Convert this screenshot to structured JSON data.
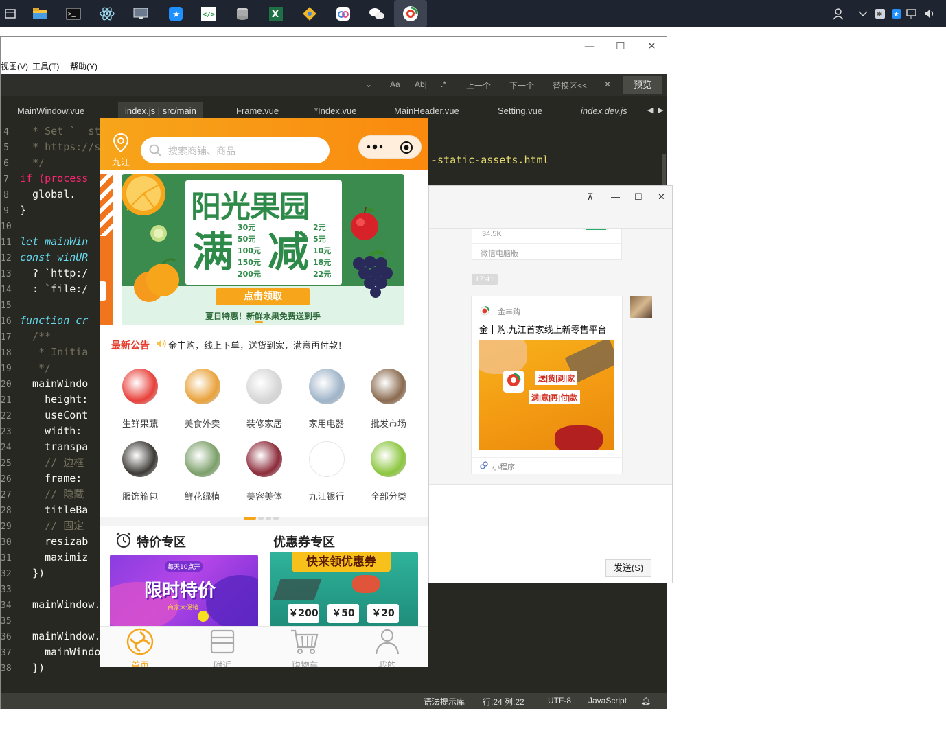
{
  "editor": {
    "menu": [
      "视图(V)",
      "工具(T)",
      "帮助(Y)"
    ],
    "find": {
      "case": "Aa",
      "word": "Ab|",
      "regex": ".*",
      "prev": "上一个",
      "next": "下一个",
      "replace": "替换区<<",
      "close": "✕"
    },
    "preview_label": "预览",
    "tabs": [
      "MainWindow.vue",
      "index.js | src/main",
      "Frame.vue",
      "*Index.vue",
      "MainHeader.vue",
      "Setting.vue",
      "index.dev.js"
    ],
    "code_lines": [
      {
        "n": "4",
        "text": "  * Set `__sta"
      },
      {
        "n": "5",
        "text": "  * https://si"
      },
      {
        "n": "6",
        "text": "  */"
      },
      {
        "n": "7",
        "text": "if (process"
      },
      {
        "n": "8",
        "text": "  global.__"
      },
      {
        "n": "9",
        "text": "}"
      },
      {
        "n": "10",
        "text": ""
      },
      {
        "n": "11",
        "text": "let mainWin"
      },
      {
        "n": "12",
        "text": "const winUR"
      },
      {
        "n": "13",
        "text": "  ? `http:/"
      },
      {
        "n": "14",
        "text": "  : `file:/"
      },
      {
        "n": "15",
        "text": ""
      },
      {
        "n": "16",
        "text": "function cr"
      },
      {
        "n": "17",
        "text": "  /**"
      },
      {
        "n": "18",
        "text": "   * Initia"
      },
      {
        "n": "19",
        "text": "   */"
      },
      {
        "n": "20",
        "text": "  mainWindo"
      },
      {
        "n": "21",
        "text": "    height:"
      },
      {
        "n": "22",
        "text": "    useCont"
      },
      {
        "n": "23",
        "text": "    width:"
      },
      {
        "n": "24",
        "text": "    transpa"
      },
      {
        "n": "25",
        "text": "    // 边框"
      },
      {
        "n": "26",
        "text": "    frame:"
      },
      {
        "n": "27",
        "text": "    // 隐藏"
      },
      {
        "n": "28",
        "text": "    titleBa"
      },
      {
        "n": "29",
        "text": "    // 固定"
      },
      {
        "n": "30",
        "text": "    resizab"
      },
      {
        "n": "31",
        "text": "    maximiz"
      },
      {
        "n": "32",
        "text": "  })"
      },
      {
        "n": "33",
        "text": ""
      },
      {
        "n": "34",
        "text": "  mainWindow."
      },
      {
        "n": "35",
        "text": ""
      },
      {
        "n": "36",
        "text": "  mainWindow."
      },
      {
        "n": "37",
        "text": "    mainWindo"
      },
      {
        "n": "38",
        "text": "  })"
      }
    ],
    "code_right": "-static-assets.html",
    "status": {
      "hint": "语法提示库",
      "pos": "行:24  列:22",
      "encoding": "UTF-8",
      "lang": "JavaScript"
    }
  },
  "wechat": {
    "card_top_count": "34.5K",
    "card_top_source": "微信电脑版",
    "time": "17:41",
    "msg_app": "金丰购",
    "msg_title": "金丰购.九江首家线上新零售平台",
    "msg_footer": "小程序",
    "poster_line1": "送|货|到|家",
    "poster_line2": "满|意|再|付|款",
    "send_label": "发送(S)"
  },
  "mini": {
    "location": "九江",
    "search_placeholder": "搜索商铺、商品",
    "banner": {
      "title": "阳光果园",
      "big_left": "满",
      "big_right": "减",
      "left_tiers": [
        "30元",
        "50元",
        "100元",
        "150元",
        "200元"
      ],
      "right_tiers": [
        "2元",
        "5元",
        "10元",
        "18元",
        "22元"
      ],
      "cta": "点击领取",
      "slogan": "夏日特惠！新鲜水果免费送到手"
    },
    "notice_title": "最新公告",
    "notice_text": "金丰购，线上下单，送货到家，满意再付款！",
    "categories": [
      {
        "label": "生鲜果蔬",
        "color": "#e8403a"
      },
      {
        "label": "美食外卖",
        "color": "#e9a23b"
      },
      {
        "label": "装修家居",
        "color": "#d6d6d6"
      },
      {
        "label": "家用电器",
        "color": "#9fb4c9"
      },
      {
        "label": "批发市场",
        "color": "#8a6a4f"
      },
      {
        "label": "服饰箱包",
        "color": "#3d3a36"
      },
      {
        "label": "鲜花绿植",
        "color": "#7ca06a"
      },
      {
        "label": "美容美体",
        "color": "#8c2b3a"
      },
      {
        "label": "九江银行",
        "color": "#ffffff"
      },
      {
        "label": "全部分类",
        "color": "#8cc63f"
      }
    ],
    "promo_left_title": "特价专区",
    "promo_left_banner": "限时特价",
    "promo_left_tag": "每天10点开",
    "promo_left_sub": "商家大促销",
    "promo_right_title": "优惠券专区",
    "promo_right_banner": "快来领优惠券",
    "coupons": [
      "￥200",
      "￥50",
      "￥20"
    ],
    "tabs": [
      {
        "label": "首页",
        "active": true
      },
      {
        "label": "附近",
        "active": false
      },
      {
        "label": "购物车",
        "active": false
      },
      {
        "label": "我的",
        "active": false
      }
    ]
  }
}
